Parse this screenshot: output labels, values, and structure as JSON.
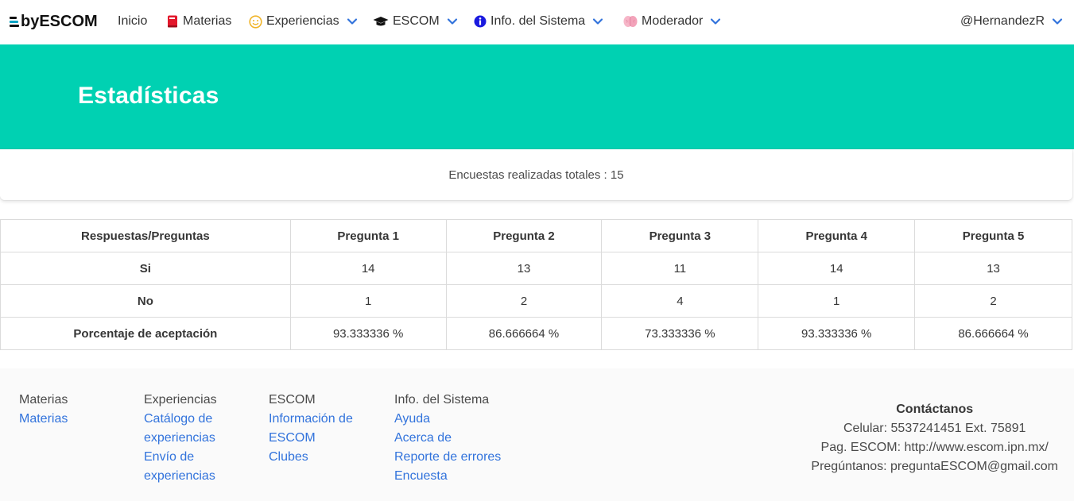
{
  "navbar": {
    "brand": "byESCOM",
    "items": [
      {
        "label": "Inicio",
        "icon": "none",
        "dropdown": false
      },
      {
        "label": "Materias",
        "icon": "book-icon",
        "dropdown": false
      },
      {
        "label": "Experiencias",
        "icon": "smile-icon",
        "dropdown": true
      },
      {
        "label": "ESCOM",
        "icon": "graduation-cap-icon",
        "dropdown": true
      },
      {
        "label": "Info. del Sistema",
        "icon": "info-circle-icon",
        "dropdown": true
      },
      {
        "label": "Moderador",
        "icon": "brain-icon",
        "dropdown": true
      }
    ],
    "user": "@HernandezR"
  },
  "hero": {
    "title": "Estadísticas",
    "color": "#00d1b2"
  },
  "summary": {
    "text": "Encuestas realizadas totales : 15"
  },
  "table": {
    "headers": [
      "Respuestas/Preguntas",
      "Pregunta 1",
      "Pregunta 2",
      "Pregunta 3",
      "Pregunta 4",
      "Pregunta 5"
    ],
    "rows": [
      {
        "label": "Si",
        "values": [
          "14",
          "13",
          "11",
          "14",
          "13"
        ]
      },
      {
        "label": "No",
        "values": [
          "1",
          "2",
          "4",
          "1",
          "2"
        ]
      },
      {
        "label": "Porcentaje de aceptación",
        "values": [
          "93.333336 %",
          "86.666664 %",
          "73.333336 %",
          "93.333336 %",
          "86.666664 %"
        ]
      }
    ]
  },
  "footer": {
    "columns": [
      {
        "title": "Materias",
        "links": [
          "Materias"
        ]
      },
      {
        "title": "Experiencias",
        "links": [
          "Catálogo de",
          "experiencias",
          "Envío de",
          "experiencias"
        ]
      },
      {
        "title": "ESCOM",
        "links": [
          "Información de",
          "ESCOM",
          "Clubes"
        ]
      },
      {
        "title": "Info. del Sistema",
        "links": [
          "Ayuda",
          "Acerca de",
          "Reporte de errores",
          "Encuesta"
        ]
      }
    ],
    "contact": {
      "title": "Contáctanos",
      "phone": "Celular: 5537241451 Ext. 75891",
      "page": "Pag. ESCOM: http://www.escom.ipn.mx/",
      "email": "Pregúntanos: preguntaESCOM@gmail.com"
    },
    "link_color": "#3273dc"
  }
}
